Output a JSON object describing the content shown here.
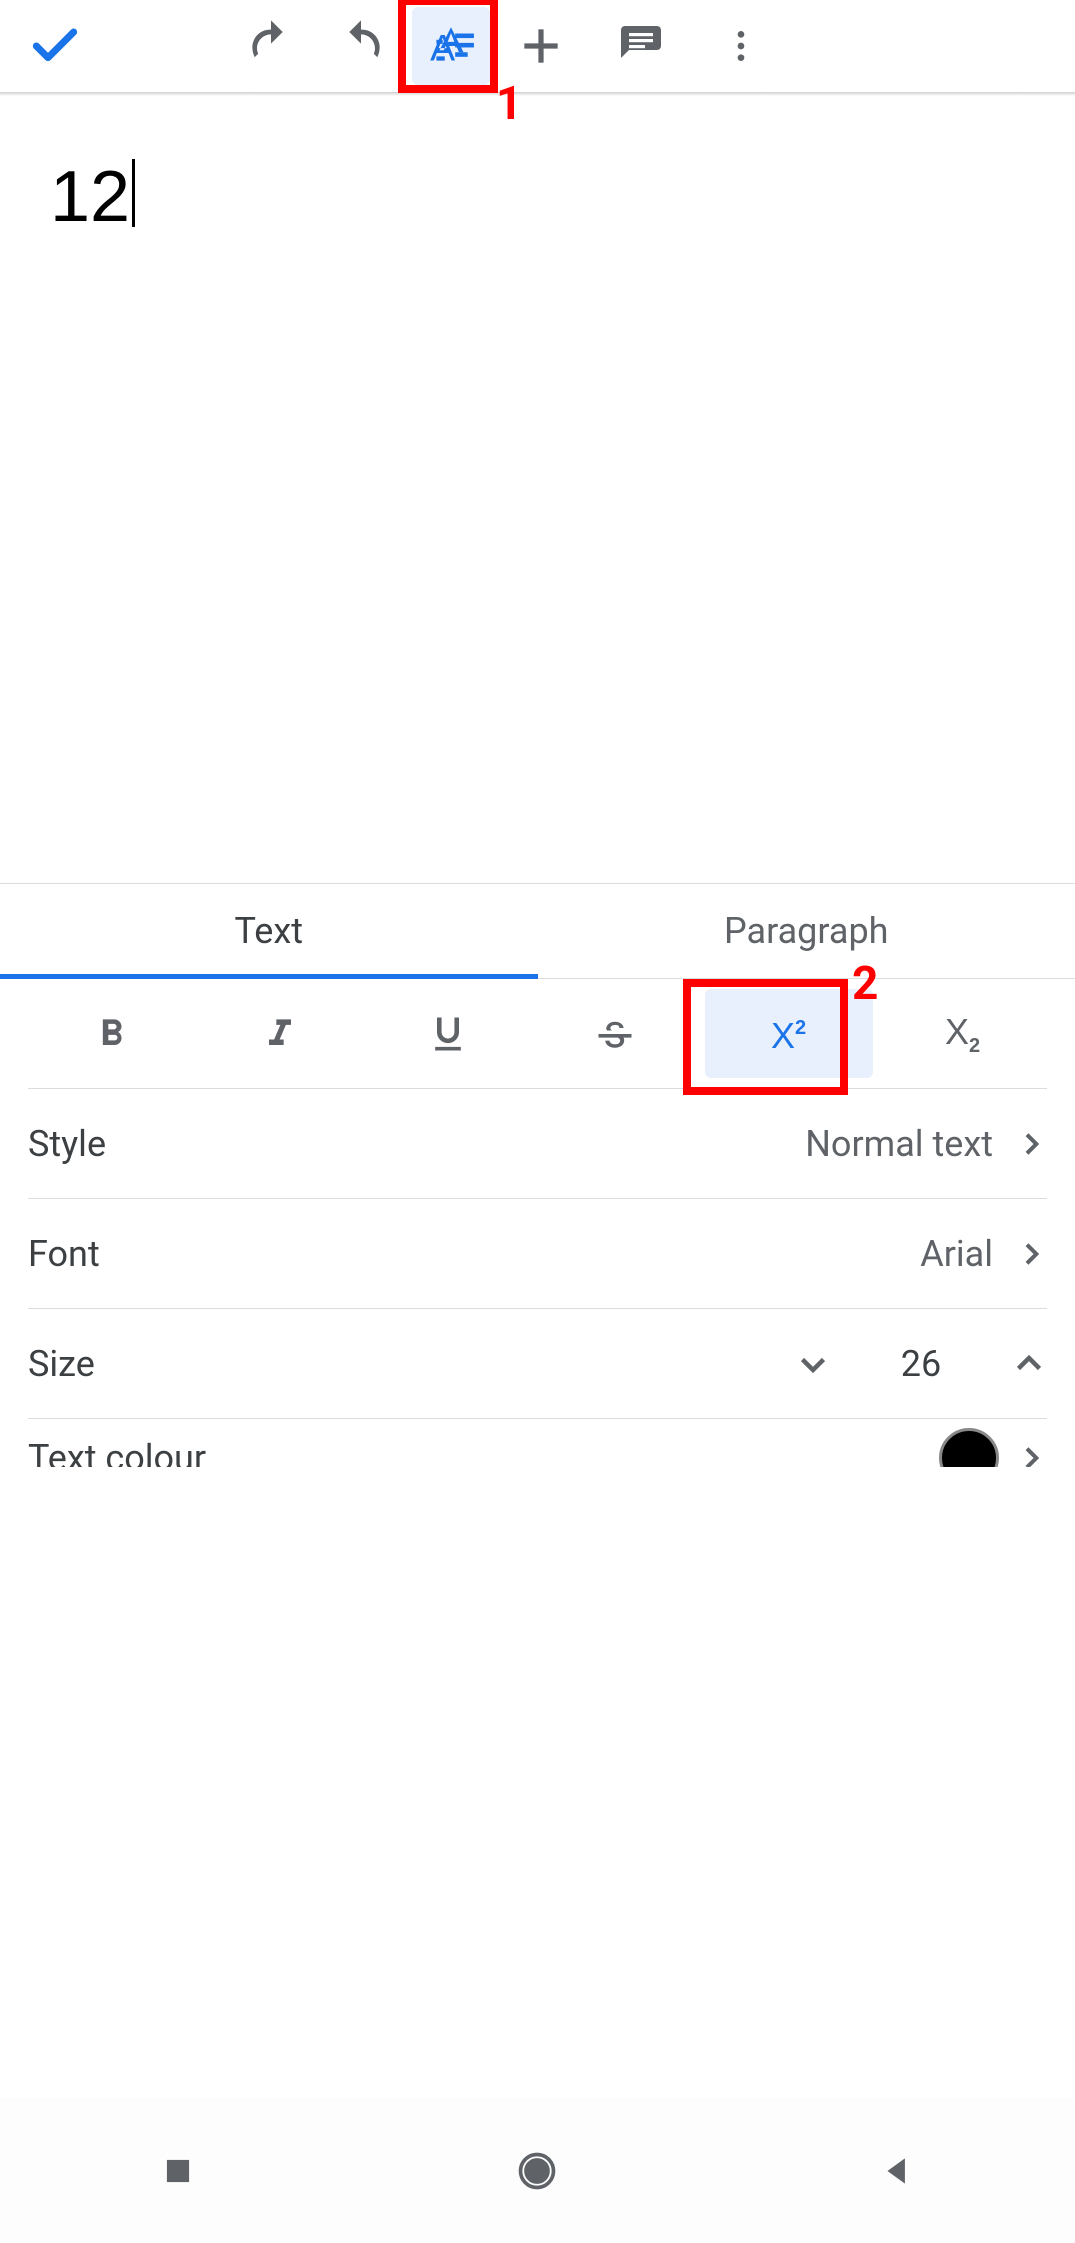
{
  "document": {
    "content": "12"
  },
  "tabs": {
    "text": "Text",
    "paragraph": "Paragraph"
  },
  "format": {
    "style_label": "Style",
    "style_value": "Normal text",
    "font_label": "Font",
    "font_value": "Arial",
    "size_label": "Size",
    "size_value": "26",
    "text_colour_label": "Text colour"
  },
  "annotations": {
    "hl1": "1",
    "hl2": "2"
  }
}
